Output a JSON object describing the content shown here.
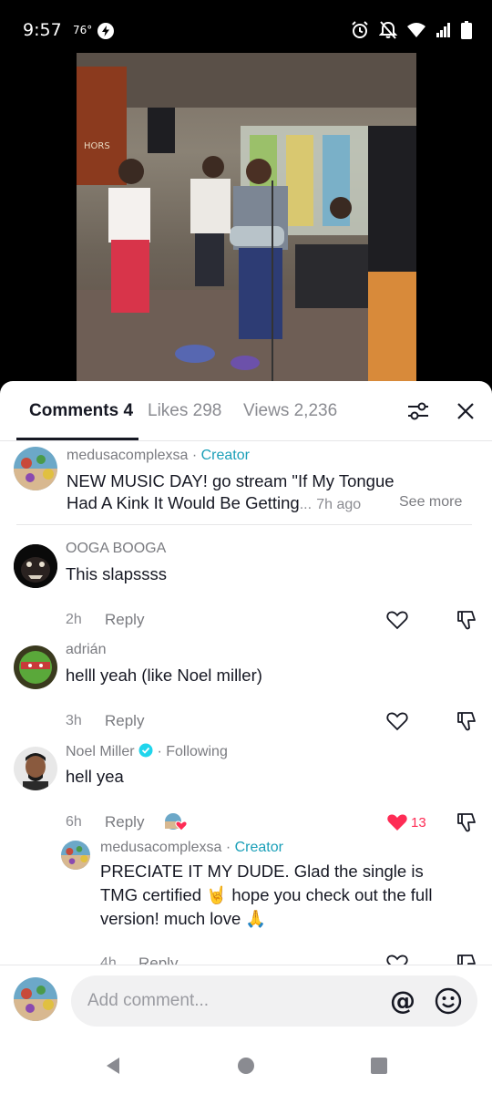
{
  "status_bar": {
    "time": "9:57",
    "temperature": "76°",
    "icons": [
      "data-saver-icon",
      "alarm-icon",
      "notifications-off-icon",
      "wifi-icon",
      "signal-icon",
      "battery-icon"
    ]
  },
  "video": {
    "icon": "video-thumbnail"
  },
  "tabs": {
    "comments": "Comments 4",
    "likes": "Likes 298",
    "views": "Views 2,236"
  },
  "comments": [
    {
      "username": "medusacomplexsa",
      "separator": " · ",
      "tag": "Creator",
      "text_line1": "NEW MUSIC DAY! go stream  \"If My Tongue",
      "text_line2": "Had A Kink It Would Be Getting",
      "ellipsis": "...",
      "time": "7h ago",
      "see_more": "See more"
    },
    {
      "username": "OOGA BOOGA",
      "text": "This slapssss",
      "time": "2h",
      "reply": "Reply"
    },
    {
      "username": "adrián",
      "text": "helll yeah (like Noel miller)",
      "time": "3h",
      "reply": "Reply"
    },
    {
      "username": "Noel Miller",
      "following": " · Following",
      "text": "hell yea",
      "time": "6h",
      "reply": "Reply",
      "like_count": "13",
      "liked": true
    }
  ],
  "reply": {
    "username": "medusacomplexsa",
    "separator": " · ",
    "tag": "Creator",
    "line1": "PRECIATE IT MY DUDE. Glad the single is",
    "line2": "TMG certified 🤘 hope you check out the full",
    "line3": "version! much love 🙏",
    "time": "4h",
    "reply": "Reply"
  },
  "composer": {
    "placeholder": "Add comment...",
    "at_symbol": "@"
  },
  "colors": {
    "creator": "#1a9fb8",
    "like_active": "#fe2c55",
    "verified": "#20d5ec"
  }
}
